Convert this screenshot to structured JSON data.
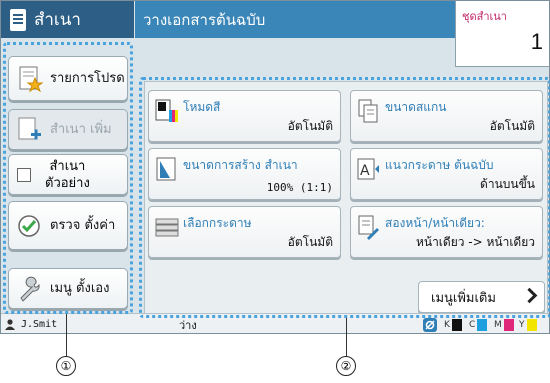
{
  "header": {
    "mode_title": "สำเนา",
    "status_message": "วางเอกสารต้นฉบับ",
    "copies_label": "ชุดสำเนา",
    "copies_value": "1"
  },
  "sidebar": {
    "favorites": "รายการโปรด",
    "copy_add": "สำเนา เพิ่ม",
    "sample_copy_line1": "สำเนา",
    "sample_copy_line2": "ตัวอย่าง",
    "check_settings": "ตรวจ ตั้งค่า",
    "custom_menu": "เมนู ตั้งเอง"
  },
  "functions": [
    {
      "label": "โหมดสี",
      "value": "อัตโนมัติ"
    },
    {
      "label": "ขนาดสแกน",
      "value": "อัตโนมัติ"
    },
    {
      "label": "ขนาดการสร้าง สำเนา",
      "value": "100% (1:1)"
    },
    {
      "label": "แนวกระดาษ ต้นฉบับ",
      "value": "ด้านบนขึ้น"
    },
    {
      "label": "เลือกกระดาษ",
      "value": "อัตโนมัติ"
    },
    {
      "label": "สองหน้า/หน้าเดียว:",
      "value": "หน้าเดียว -> หน้าเดียว"
    }
  ],
  "more_menu": "เมนูเพิ่มเติม",
  "statusbar": {
    "user": "J.Smit",
    "state": "ว่าง",
    "inks": [
      {
        "name": "K",
        "color": "#111111"
      },
      {
        "name": "C",
        "color": "#1ea0e0"
      },
      {
        "name": "M",
        "color": "#e0287a"
      },
      {
        "name": "Y",
        "color": "#f2e600"
      }
    ]
  },
  "callouts": [
    "①",
    "②"
  ],
  "colors": {
    "header_dark": "#2d5f86",
    "header_light": "#3a86b8",
    "accent_label": "#2f7fb6",
    "copies_label": "#c3286b"
  }
}
